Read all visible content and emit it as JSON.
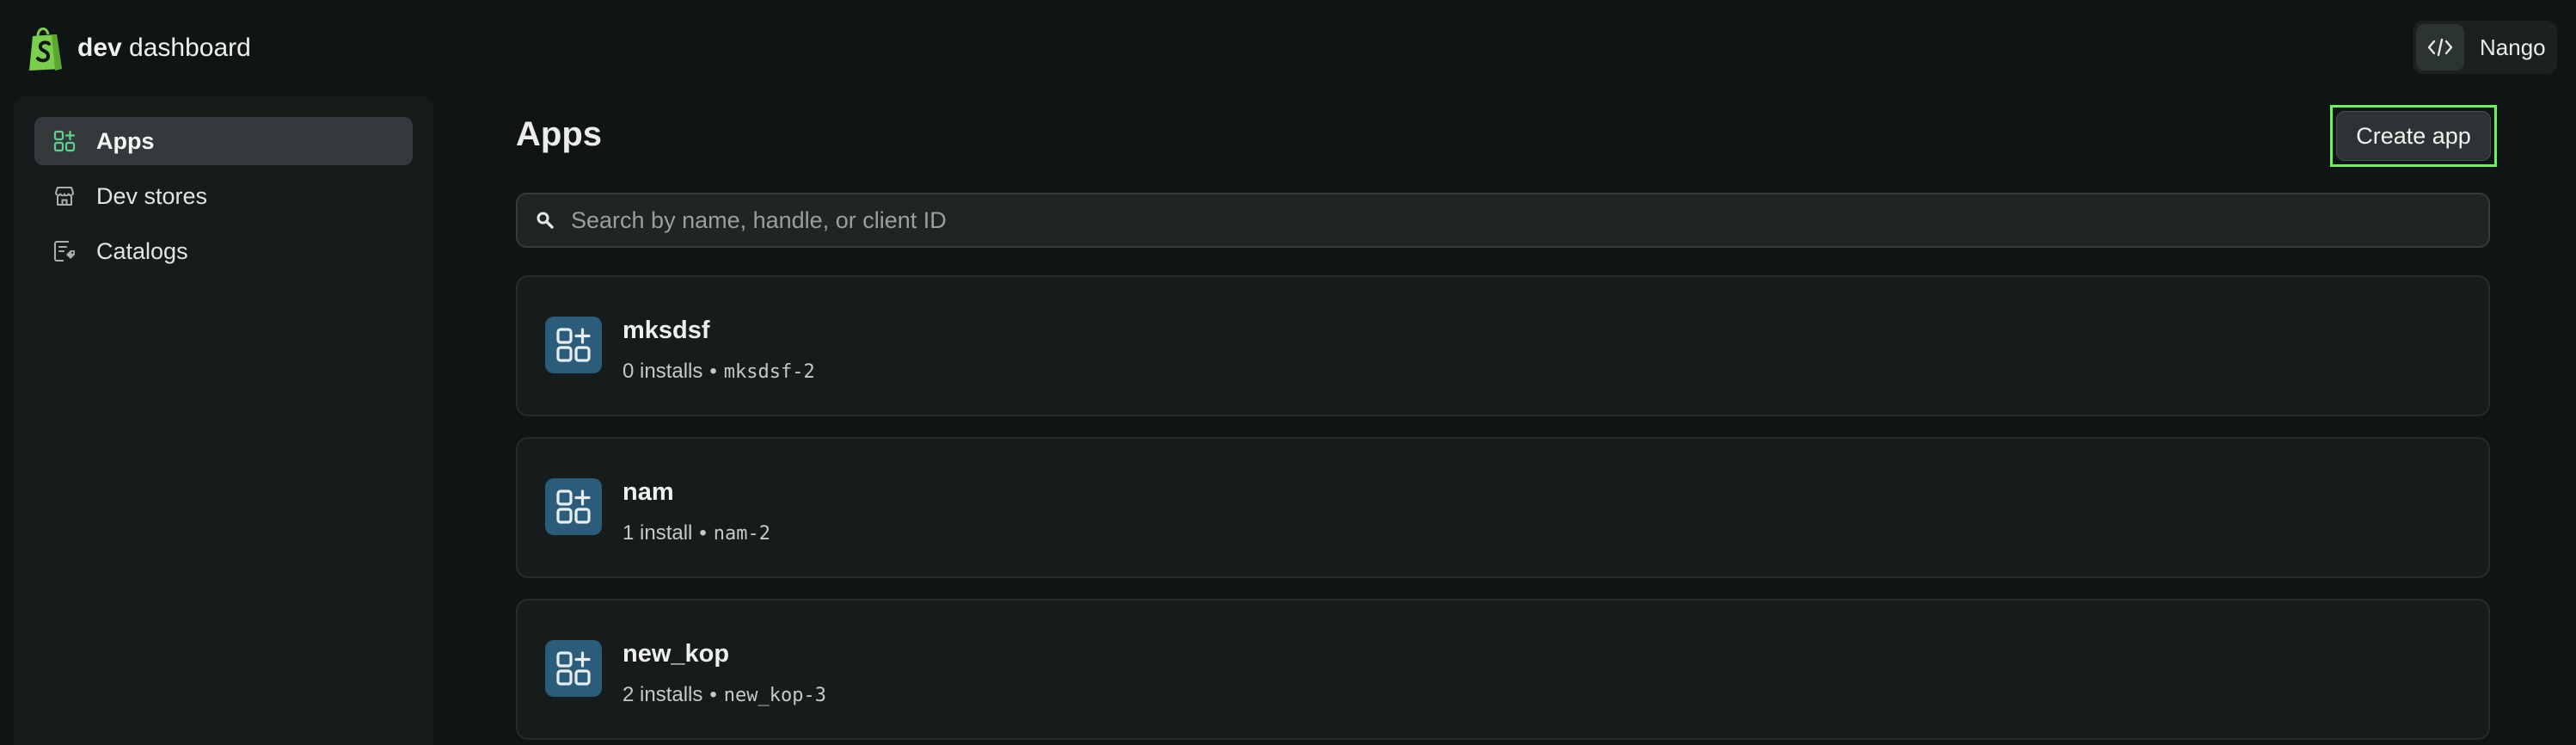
{
  "header": {
    "brand_bold": "dev",
    "brand_rest": "dashboard",
    "logo_icon": "shopify-bag-icon",
    "org": {
      "icon": "code-icon",
      "name": "Nango"
    }
  },
  "sidebar": {
    "items": [
      {
        "label": "Apps",
        "icon": "apps-grid-icon",
        "active": true
      },
      {
        "label": "Dev stores",
        "icon": "store-icon",
        "active": false
      },
      {
        "label": "Catalogs",
        "icon": "catalog-icon",
        "active": false
      }
    ]
  },
  "main": {
    "title": "Apps",
    "create_label": "Create app",
    "search": {
      "placeholder": "Search by name, handle, or client ID",
      "value": ""
    },
    "apps": [
      {
        "name": "mksdsf",
        "installs": "0 installs",
        "separator": "•",
        "handle": "mksdsf-2"
      },
      {
        "name": "nam",
        "installs": "1 install",
        "separator": "•",
        "handle": "nam-2"
      },
      {
        "name": "new_kop",
        "installs": "2 installs",
        "separator": "•",
        "handle": "new_kop-3"
      }
    ]
  },
  "colors": {
    "background": "#0f1414",
    "sidebar": "#161c1c",
    "highlight_border": "#6cf25a",
    "app_icon_bg": "#2b5c7a",
    "logo_green": "#7ad04c"
  }
}
